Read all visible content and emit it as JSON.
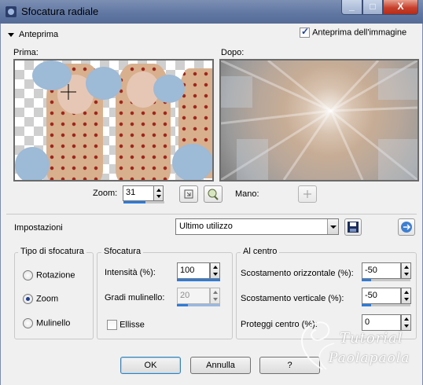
{
  "window": {
    "title": "Sfocatura radiale",
    "close_label": "X",
    "minimize_label": "_",
    "maximize_label": "□"
  },
  "preview": {
    "toggle_label": "Anteprima",
    "image_preview_label": "Anteprima dell'immagine",
    "image_preview_checked": true,
    "before_label": "Prima:",
    "after_label": "Dopo:"
  },
  "zoom": {
    "label": "Zoom:",
    "value": "31",
    "pan_label": "Mano:"
  },
  "settings": {
    "label": "Impostazioni",
    "preset_value": "Ultimo utilizzo"
  },
  "blur_type": {
    "group_label": "Tipo di sfocatura",
    "options": [
      "Rotazione",
      "Zoom",
      "Mulinello"
    ],
    "selected": "Zoom"
  },
  "blur": {
    "group_label": "Sfocatura",
    "intensity_label": "Intensità (%):",
    "intensity_value": "100",
    "twirl_label": "Gradi mulinello:",
    "twirl_value": "20",
    "ellipse_label": "Ellisse",
    "ellipse_checked": false
  },
  "center": {
    "group_label": "Al centro",
    "h_offset_label": "Scostamento orizzontale (%):",
    "h_offset_value": "-50",
    "v_offset_label": "Scostamento verticale (%):",
    "v_offset_value": "-50",
    "protect_label": "Proteggi centro (%):",
    "protect_value": "0"
  },
  "buttons": {
    "ok": "OK",
    "cancel": "Annulla",
    "help": "?"
  },
  "watermark": {
    "line1": "Tutorial",
    "line2": "Paolapaola"
  }
}
